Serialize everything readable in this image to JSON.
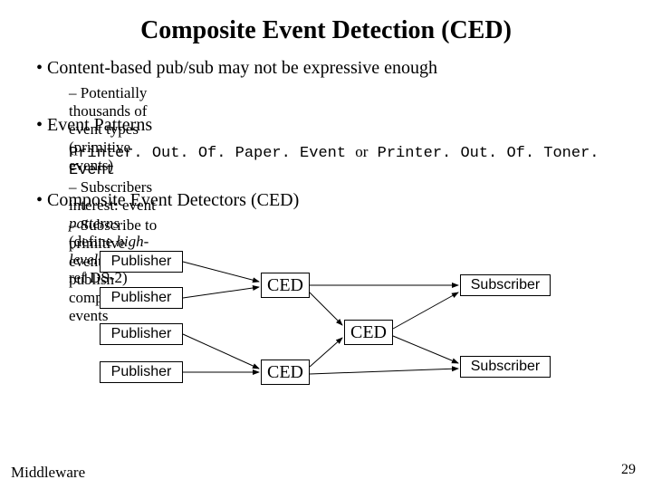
{
  "title": "Composite Event Detection (CED)",
  "bullets": {
    "b1": "Content-based pub/sub may not be expressive enough",
    "b1_sub1": "Potentially thousands of event types (primitive events)",
    "b1_sub2_a": "Subscribers interest: event ",
    "b1_sub2_b": "patterns",
    "b1_sub2_c": " (define ",
    "b1_sub2_d": "high-level",
    "b1_sub2_e": " events,  ref DS-2)",
    "b2": "Event Patterns",
    "code_a": "Printer. Out. Of. Paper. Event ",
    "code_or": "or",
    "code_b": " Printer. Out. Of. Toner. Event",
    "b3": "Composite Event Detectors (CED)",
    "b3_sub1": "Subscribe to primitive events and publish composite events"
  },
  "boxes": {
    "publisher": "Publisher",
    "ced": "CED",
    "subscriber": "Subscriber"
  },
  "footer": {
    "left": "Middleware",
    "page": "29"
  }
}
